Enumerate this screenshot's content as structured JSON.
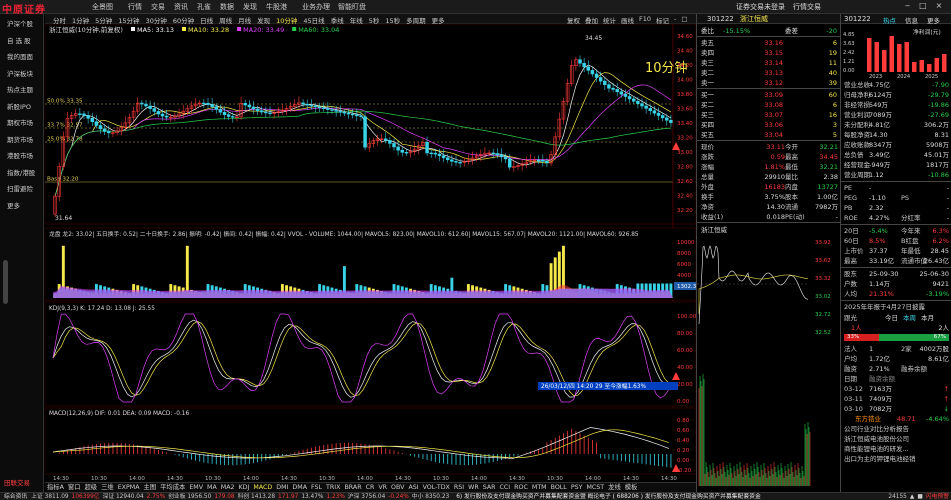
{
  "app": {
    "logo": "中原证券"
  },
  "menu": [
    "全景图",
    "行情",
    "交易",
    "资讯",
    "孔雀",
    "数据",
    "发现",
    "牛股港",
    "业务办理",
    "智能盯盘"
  ],
  "topright": [
    "证券交易未登录",
    "行情交易"
  ],
  "window_controls": [
    "‒",
    "□",
    "×"
  ],
  "sidebar": [
    "沪深个股",
    "自 选 股",
    "我的面面",
    "沪深板块",
    "热点主题",
    "新股IPO",
    "期权市场",
    "期货市场",
    "港股市场",
    "指数/港股",
    "扫雷避险",
    "更多"
  ],
  "sidebar_bottom": "田联交易",
  "toolbar": {
    "periods": [
      "分时",
      "1分钟",
      "5分钟",
      "15分钟",
      "30分钟",
      "60分钟",
      "日线",
      "周线",
      "月线",
      "发现",
      "10分钟",
      "45日线",
      "季线",
      "年线",
      "5秒",
      "15秒",
      "多周期",
      "更多"
    ],
    "active_period": "10分钟",
    "right": [
      "复权",
      "叠加",
      "统计",
      "画线",
      "F10",
      "标记",
      "-",
      "□"
    ]
  },
  "chart": {
    "title": "浙江恒威(10分钟,前复权)",
    "ma_legend": [
      {
        "label": "MA5: 33.13",
        "color": "#f5f5f5"
      },
      {
        "label": "MA10: 33.28",
        "color": "#f5e84a"
      },
      {
        "label": "MA20: 33.49",
        "color": "#e040fb"
      },
      {
        "label": "MA60: 33.04",
        "color": "#26d04a"
      }
    ],
    "watermark": "10分钟",
    "fib_levels": [
      {
        "label": "50.0% 33.35"
      },
      {
        "label": "33.7% 32.97"
      },
      {
        "label": "25.0% 32.78"
      },
      {
        "label": "Base 32.20"
      }
    ],
    "high_label": "34.45",
    "low_label": "31.64",
    "price_axis": [
      "34.60",
      "34.40",
      "34.20",
      "34.00",
      "33.80",
      "33.60",
      "33.40",
      "33.20",
      "33.00",
      "32.80",
      "32.60",
      "32.40",
      "32.20"
    ],
    "vol_legend": "龙盘  龙2: 33.02|  五日换手: 0.52|  二十日换手: 2.86|  振明: -0.42|  振间: 0.42|  振幅: 0.42|  VVOL - VOLUME: 1044.00|  MAVOL5: 823.00|  MAVOL10: 612.60|  MAVOL15: 567.07|  MAVOL20: 1121.00|  MAVOL60: 926.85",
    "vol_axis": [
      "10000",
      "8000",
      "6000",
      "4000",
      "2000",
      "1302.35"
    ],
    "kdj_legend": "KDJ(9,3,3)  K: 17.24  D: 13.08  J: 25.55",
    "kdj_axis": [
      "100.00",
      "80.00",
      "60.00",
      "40.00",
      "20.00",
      "0.00"
    ],
    "macd_legend": "MACD(12,26,9)  DIF: 0.01  DEA: 0.09  MACD: -0.16",
    "macd_axis": [
      "0.80",
      "0.60",
      "0.40",
      "0.20",
      "0.00",
      "-0.20"
    ],
    "crosshair_info": "26/03/12/四 14:20 29 至今涨幅1.63%",
    "time_axis": [
      "14:30",
      "10:30",
      "14:00",
      "14:30",
      "10:30",
      "14:00",
      "14:30",
      "10:30",
      "14:00",
      "14:30",
      "10:30",
      "14:00",
      "14:30",
      "10:30",
      "14:00",
      "14:30",
      "14:30"
    ]
  },
  "indicator_tabs": [
    "指标A",
    "窗口",
    "超级",
    "三维",
    "EXPMA",
    "主图",
    "平均成本",
    "EMV",
    "MA",
    "MA2",
    "KDJ",
    "MACD",
    "DMI",
    "DMA",
    "FSL",
    "TRIX",
    "BRAR",
    "CR",
    "VR",
    "OBV",
    "ASI",
    "VOL-TDX",
    "RSI",
    "WR",
    "SAR",
    "CCI",
    "ROC",
    "MTM",
    "BOLL",
    "PSY",
    "MCST",
    "龙线",
    "模板"
  ],
  "active_tab": "MACD",
  "order": {
    "code": "301222",
    "name": "浙江恒威",
    "wei_bi": "-15.15%",
    "wei_cha": "-20",
    "asks": [
      {
        "label": "卖五",
        "price": "33.16",
        "vol": "6"
      },
      {
        "label": "卖四",
        "price": "33.15",
        "vol": "19"
      },
      {
        "label": "卖三",
        "price": "33.14",
        "vol": "11"
      },
      {
        "label": "卖二",
        "price": "33.13",
        "vol": "40"
      },
      {
        "label": "卖一",
        "price": "33.12",
        "vol": "39"
      }
    ],
    "bids": [
      {
        "label": "买一",
        "price": "33.09",
        "vol": "60"
      },
      {
        "label": "买二",
        "price": "33.08",
        "vol": "6"
      },
      {
        "label": "买三",
        "price": "33.07",
        "vol": "16"
      },
      {
        "label": "买四",
        "price": "33.06",
        "vol": "3"
      },
      {
        "label": "买五",
        "price": "33.04",
        "vol": "5"
      }
    ],
    "stats": [
      {
        "l": "现价",
        "a": "33.11",
        "k": "今开",
        "v": "32.21",
        "ac": "red",
        "vc": "green"
      },
      {
        "l": "涨跌",
        "a": "0.59",
        "k": "最高",
        "v": "34.45",
        "ac": "red",
        "vc": "red"
      },
      {
        "l": "涨幅",
        "a": "1.81%",
        "k": "最低",
        "v": "32.21",
        "ac": "red",
        "vc": "green"
      },
      {
        "l": "总量",
        "a": "29910",
        "k": "量比",
        "v": "2.38",
        "ac": "white",
        "vc": "white"
      },
      {
        "l": "外盘",
        "a": "16183",
        "k": "内盘",
        "v": "13727",
        "ac": "red",
        "vc": "green"
      },
      {
        "l": "换手",
        "a": "3.75%",
        "k": "股本",
        "v": "1.00亿",
        "ac": "white",
        "vc": "white"
      },
      {
        "l": "净资",
        "a": "14.30",
        "k": "流通",
        "v": "7982万",
        "ac": "white",
        "vc": "white"
      },
      {
        "l": "收益(1)",
        "a": "0.018",
        "k": "PE(动)",
        "v": "-",
        "ac": "white",
        "vc": "white"
      }
    ],
    "sub_title": "浙江恒威",
    "intraday_axis": [
      "33.92",
      "33.62",
      "33.32",
      "33.02",
      "32.72",
      "32.52"
    ]
  },
  "f10": {
    "code": "301222",
    "tabs": [
      "热点",
      "信息",
      "更多"
    ],
    "bars_title": "净利润(元)",
    "bars_axis": [
      "4.85",
      "3.63",
      "2.42",
      "1.21",
      "0.00"
    ],
    "bar_years": [
      "2023",
      "2024",
      "2025"
    ],
    "rows1": [
      {
        "l": "营业总收",
        "m": "4.75亿",
        "v": "-7.90",
        "mc": "white",
        "vc": "green"
      },
      {
        "l": "归母净利",
        "m": "6124万",
        "v": "-29.79",
        "mc": "white",
        "vc": "green"
      },
      {
        "l": "非经常损",
        "m": "549万",
        "v": "-19.86",
        "mc": "white",
        "vc": "green"
      },
      {
        "l": "营业利润",
        "m": "7089万",
        "v": "-27.69",
        "mc": "white",
        "vc": "green"
      },
      {
        "l": "未分配利",
        "m": "4.81亿",
        "v": "306.2万",
        "mc": "white",
        "vc": "white"
      },
      {
        "l": "每股净资",
        "m": "14.30",
        "v": "8.31",
        "mc": "white",
        "vc": "white"
      },
      {
        "l": "应收账款",
        "m": "8347万",
        "v": "5908万",
        "mc": "white",
        "vc": "white"
      },
      {
        "l": "总负债",
        "m": "3.49亿",
        "v": "45.01万",
        "mc": "white",
        "vc": "white"
      },
      {
        "l": "经营现金",
        "m": "-949万",
        "v": "1817万",
        "mc": "white",
        "vc": "white"
      },
      {
        "l": "营业周期",
        "m": "1.12",
        "v": "-10.86",
        "mc": "white",
        "vc": "green"
      }
    ],
    "rows2": [
      {
        "l": "PE",
        "m": "-",
        "v": "-",
        "mc": "white",
        "vc": "white"
      },
      {
        "l": "PEG",
        "m": "-1.10",
        "k": "PS",
        "v": "-",
        "mc": "white",
        "vc": "white"
      },
      {
        "l": "PB",
        "m": "2.32",
        "v": "-",
        "mc": "white",
        "vc": "white"
      },
      {
        "l": "ROE",
        "m": "4.27%",
        "k": "分红率",
        "v": "-",
        "mc": "white",
        "vc": "white"
      }
    ],
    "rows3": [
      {
        "l": "20日",
        "m": "-5.4%",
        "k": "今年来",
        "v": "6.3%",
        "mc": "green",
        "vc": "red"
      },
      {
        "l": "60日",
        "m": "8.5%",
        "k": "B红盘",
        "v": "6.2%",
        "mc": "red",
        "vc": "red"
      },
      {
        "l": "上市价",
        "m": "37.37",
        "k": "年最低",
        "v": "28.45",
        "mc": "white",
        "vc": "white"
      },
      {
        "l": "最高",
        "m": "33.19亿",
        "k": "流通市值",
        "v": "26.43亿",
        "mc": "white",
        "vc": "white"
      }
    ],
    "rows4": [
      {
        "l": "股东",
        "m": "25-09-30",
        "v": "25-06-30",
        "mc": "white",
        "vc": "white"
      },
      {
        "l": "户数",
        "m": "1.14万",
        "v": "9421",
        "mc": "white",
        "vc": "white"
      },
      {
        "l": "人均",
        "m": "21.31%",
        "v": "-3.19%",
        "mc": "red",
        "vc": "green"
      }
    ],
    "report_title": "2025年年报于4月27日披露",
    "vote": {
      "label": "跟光",
      "today": "今日",
      "up": "本周",
      "down": "本月",
      "count": "2人",
      "up_pct": "33%",
      "down_pct": "67%",
      "n1": "1人"
    },
    "rows5": [
      {
        "l": "法人",
        "m": "1",
        "k": "2家",
        "v": "4002万股",
        "mc": "white",
        "vc": "white"
      },
      {
        "l": "户均",
        "m": "1.72亿",
        "k": "",
        "v": "8.61亿",
        "mc": "white",
        "vc": "white"
      },
      {
        "l": "融资",
        "m": "2.71%",
        "k": "融券余额",
        "v": "",
        "mc": "white",
        "vc": "white"
      },
      {
        "l": "日期",
        "m": "融资余额",
        "v": "",
        "mc": "gray",
        "vc": "white"
      },
      {
        "l": "03-12",
        "m": "7163万",
        "v": "↑",
        "mc": "white",
        "vc": "red"
      },
      {
        "l": "03-11",
        "m": "7409万",
        "v": "↑",
        "mc": "white",
        "vc": "red"
      },
      {
        "l": "03-10",
        "m": "7082万",
        "v": "↓",
        "mc": "white",
        "vc": "green"
      }
    ],
    "news": [
      {
        "name": "东方锆业",
        "price": "48.71",
        "chg": "-4.64%"
      },
      {
        "text": "公司行业对比分析报告"
      },
      {
        "text": "浙江恒威电池股份公司"
      },
      {
        "text": "商性能锂电池的研发..."
      },
      {
        "text": "出口为主的钾锂电池经销"
      }
    ]
  },
  "status": {
    "left": "综合资讯",
    "items": [
      "上证 3811.09",
      "106399亿",
      "深证 12940.04",
      "2.75%",
      "创业板 1956.50",
      "179.08",
      "科创 1413.28",
      "171.97",
      "13.47%",
      "1.23%",
      "沪深 3756.04",
      "-0.24%",
      "中小 8350.23"
    ],
    "ticker": "6) 发行股份及支付现金购买资产并募集配套资金暨   概论电子 ( 688206 )  发行股份及支付现金购买资产并募集配套资金",
    "right": [
      "24155",
      "▲",
      "■",
      "闪电预警"
    ]
  }
}
